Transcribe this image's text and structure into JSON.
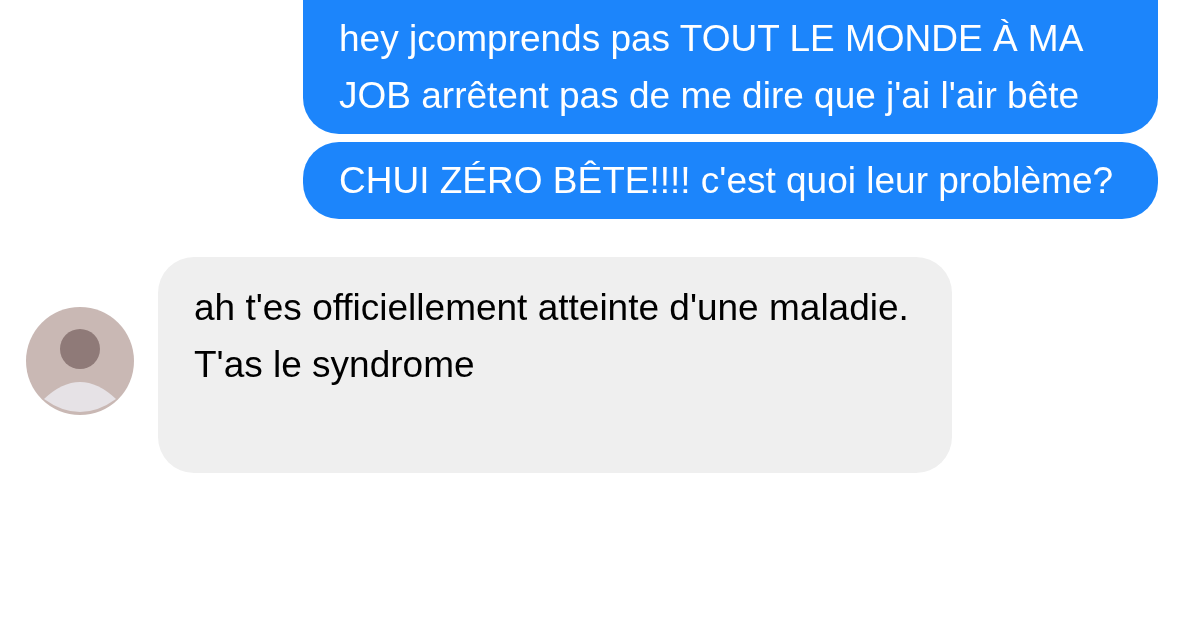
{
  "messages": [
    {
      "kind": "sent",
      "text": "hey jcomprends pas TOUT LE MONDE À MA JOB arrêtent pas de me dire que j'ai l'air bête"
    },
    {
      "kind": "sent",
      "text": "CHUI ZÉRO BÊTE!!!! c'est quoi leur problème?"
    },
    {
      "kind": "received",
      "text": "ah t'es officiellement atteinte d'une maladie. T'as le syndrome"
    }
  ]
}
